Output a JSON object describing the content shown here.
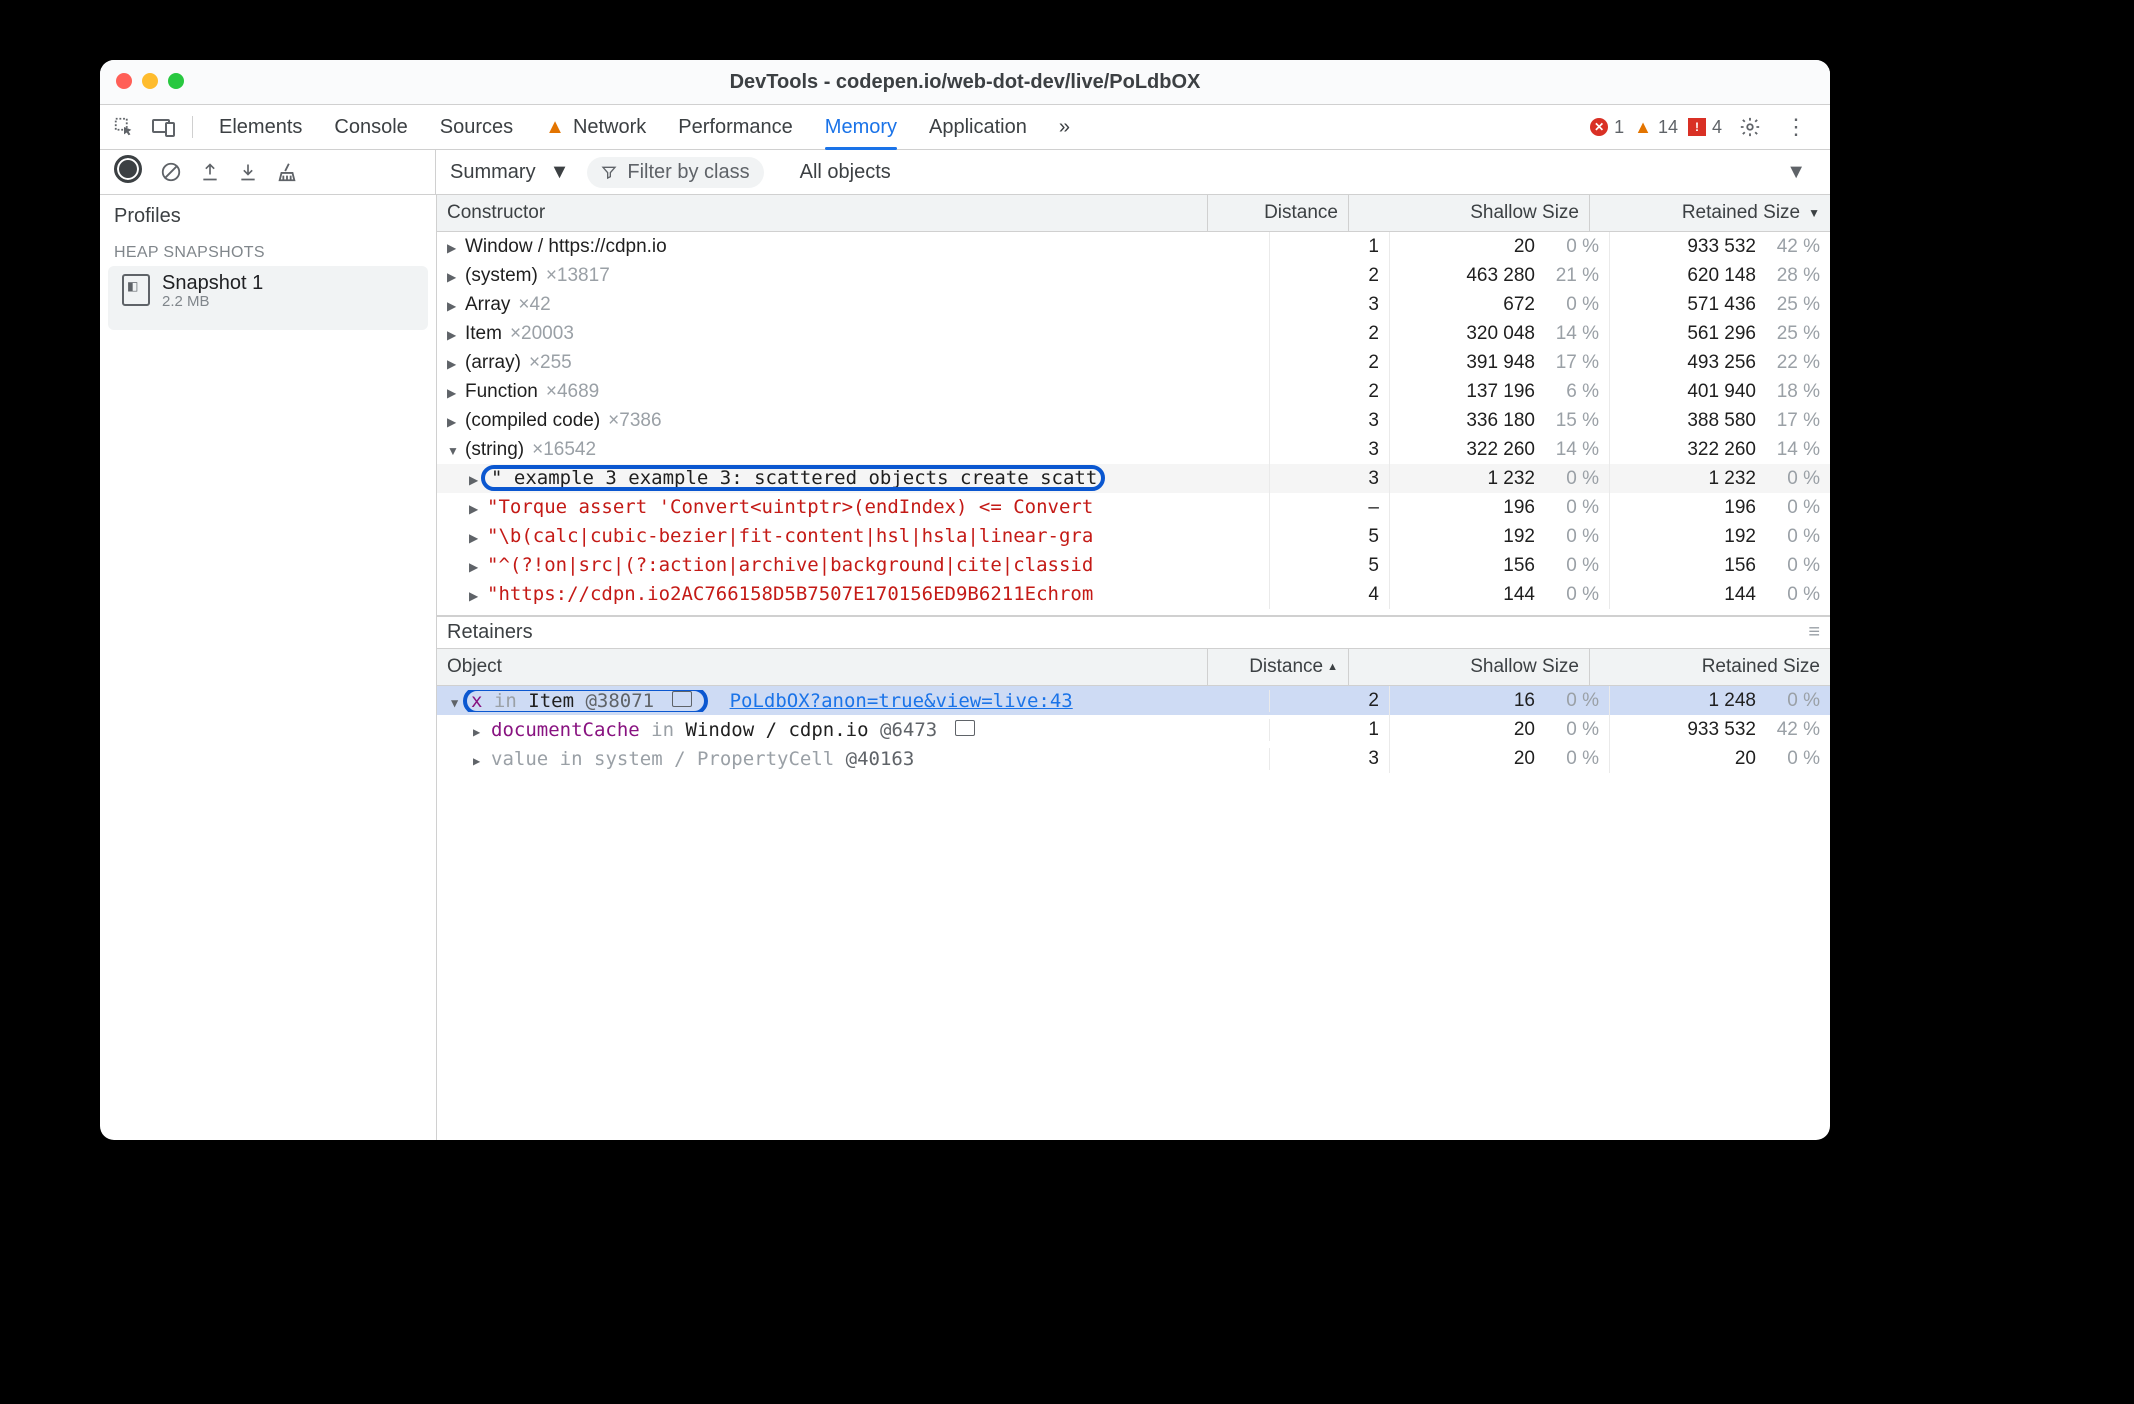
{
  "title": "DevTools - codepen.io/web-dot-dev/live/PoLdbOX",
  "tabs": {
    "elements": "Elements",
    "console": "Console",
    "sources": "Sources",
    "network": "Network",
    "performance": "Performance",
    "memory": "Memory",
    "application": "Application",
    "more_glyph": "»"
  },
  "status": {
    "error_count": "1",
    "warn_count": "14",
    "issue_count": "4"
  },
  "toolbar": {
    "view_label": "Summary",
    "filter_placeholder": "Filter by class",
    "scope_label": "All objects"
  },
  "sidebar": {
    "profiles_label": "Profiles",
    "section_label": "HEAP SNAPSHOTS",
    "snapshot": {
      "name": "Snapshot 1",
      "size": "2.2 MB"
    }
  },
  "columns": {
    "constructor": "Constructor",
    "distance": "Distance",
    "shallow": "Shallow Size",
    "retained": "Retained Size"
  },
  "rows": [
    {
      "ind": 1,
      "disc": "▶",
      "label": "Window / https://cdpn.io",
      "count": "",
      "dist": "1",
      "sh": "20",
      "shp": "0 %",
      "ret": "933 532",
      "retp": "42 %"
    },
    {
      "ind": 1,
      "disc": "▶",
      "label": "(system)",
      "count": "×13817",
      "dist": "2",
      "sh": "463 280",
      "shp": "21 %",
      "ret": "620 148",
      "retp": "28 %"
    },
    {
      "ind": 1,
      "disc": "▶",
      "label": "Array",
      "count": "×42",
      "dist": "3",
      "sh": "672",
      "shp": "0 %",
      "ret": "571 436",
      "retp": "25 %"
    },
    {
      "ind": 1,
      "disc": "▶",
      "label": "Item",
      "count": "×20003",
      "dist": "2",
      "sh": "320 048",
      "shp": "14 %",
      "ret": "561 296",
      "retp": "25 %"
    },
    {
      "ind": 1,
      "disc": "▶",
      "label": "(array)",
      "count": "×255",
      "dist": "2",
      "sh": "391 948",
      "shp": "17 %",
      "ret": "493 256",
      "retp": "22 %"
    },
    {
      "ind": 1,
      "disc": "▶",
      "label": "Function",
      "count": "×4689",
      "dist": "2",
      "sh": "137 196",
      "shp": "6 %",
      "ret": "401 940",
      "retp": "18 %"
    },
    {
      "ind": 1,
      "disc": "▶",
      "label": "(compiled code)",
      "count": "×7386",
      "dist": "3",
      "sh": "336 180",
      "shp": "15 %",
      "ret": "388 580",
      "retp": "17 %"
    },
    {
      "ind": 1,
      "disc": "▼",
      "label": "(string)",
      "count": "×16542",
      "dist": "3",
      "sh": "322 260",
      "shp": "14 %",
      "ret": "322 260",
      "retp": "14 %"
    },
    {
      "ind": 2,
      "disc": "▶",
      "mono": true,
      "hi": true,
      "ring": true,
      "str": "\" example 3 example 3: scattered objects create scatt",
      "dist": "3",
      "sh": "1 232",
      "shp": "0 %",
      "ret": "1 232",
      "retp": "0 %"
    },
    {
      "ind": 2,
      "disc": "▶",
      "mono": true,
      "red": true,
      "str": "\"Torque assert 'Convert<uintptr>(endIndex) <= Convert",
      "dist": "–",
      "sh": "196",
      "shp": "0 %",
      "ret": "196",
      "retp": "0 %"
    },
    {
      "ind": 2,
      "disc": "▶",
      "mono": true,
      "red": true,
      "str": "\"\\b(calc|cubic-bezier|fit-content|hsl|hsla|linear-gra",
      "dist": "5",
      "sh": "192",
      "shp": "0 %",
      "ret": "192",
      "retp": "0 %"
    },
    {
      "ind": 2,
      "disc": "▶",
      "mono": true,
      "red": true,
      "str": "\"^(?!on|src|(?:action|archive|background|cite|classid",
      "dist": "5",
      "sh": "156",
      "shp": "0 %",
      "ret": "156",
      "retp": "0 %"
    },
    {
      "ind": 2,
      "disc": "▶",
      "mono": true,
      "red": true,
      "str": "\"https://cdpn.io2AC766158D5B7507E170156ED9B6211Echrom",
      "dist": "4",
      "sh": "144",
      "shp": "0 %",
      "ret": "144",
      "retp": "0 %"
    }
  ],
  "retainers": {
    "header": "Retainers",
    "columns": {
      "object": "Object",
      "distance": "Distance",
      "shallow": "Shallow Size",
      "retained": "Retained Size"
    },
    "rows": [
      {
        "sel": true,
        "ring": true,
        "disc": "▼",
        "prop": "x",
        "in_kw": "in",
        "cls": "Item",
        "id": "@38071",
        "link": "PoLdbOX?anon=true&view=live:43",
        "dist": "2",
        "sh": "16",
        "shp": "0 %",
        "ret": "1 248",
        "retp": "0 %"
      },
      {
        "ind": 2,
        "disc": "▶",
        "prop": "documentCache",
        "in_kw": "in",
        "cls": "Window / cdpn.io",
        "id": "@6473",
        "dist": "1",
        "sh": "20",
        "shp": "0 %",
        "ret": "933 532",
        "retp": "42 %"
      },
      {
        "ind": 2,
        "disc": "▶",
        "dim": true,
        "prop": "value",
        "in_kw": "in",
        "cls": "system / PropertyCell",
        "id": "@40163",
        "dist": "3",
        "sh": "20",
        "shp": "0 %",
        "ret": "20",
        "retp": "0 %"
      }
    ]
  }
}
